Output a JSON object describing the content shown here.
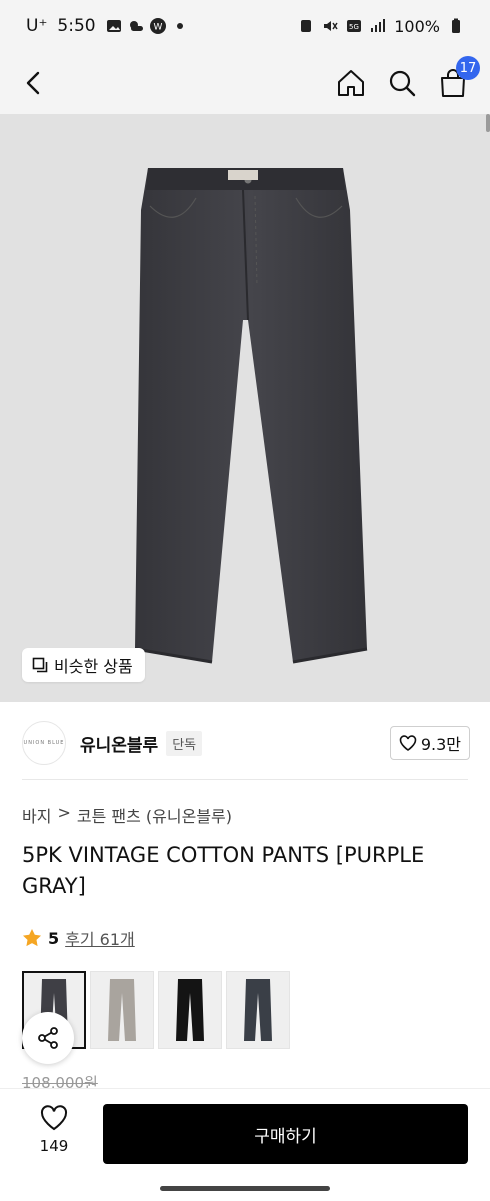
{
  "status_bar": {
    "carrier": "U⁺",
    "time": "5:50",
    "battery": "100%"
  },
  "nav": {
    "cart_count": "17"
  },
  "hero": {
    "similar_label": "비슷한 상품"
  },
  "brand": {
    "logo_text": "UNION BLUE",
    "name": "유니온블루",
    "tag": "단독",
    "likes": "9.3만"
  },
  "breadcrumb": {
    "category": "바지",
    "separator": ">",
    "subcategory": "코튼 팬츠 (유니온블루)"
  },
  "product": {
    "title": "5PK VINTAGE COTTON PANTS [PURPLE GRAY]",
    "rating": "5",
    "reviews": "후기 61개",
    "original_price": "108,000원"
  },
  "thumbnails": [
    {
      "color": "#3f3f45",
      "selected": true
    },
    {
      "color": "#a9a49e",
      "selected": false
    },
    {
      "color": "#141414",
      "selected": false
    },
    {
      "color": "#3a3f47",
      "selected": false
    }
  ],
  "bottom_bar": {
    "wish_count": "149",
    "buy_label": "구매하기"
  },
  "colors": {
    "badge": "#3366ee",
    "star": "#f5a623",
    "buy_button": "#000000"
  }
}
